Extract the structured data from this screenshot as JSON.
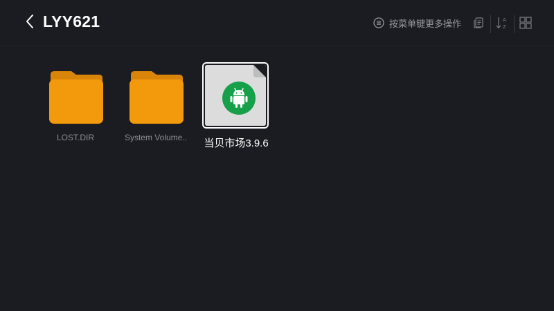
{
  "header": {
    "title": "LYY621",
    "menu_hint": "按菜单键更多操作",
    "icons": {
      "back": "chevron-left-icon",
      "menu_hint": "menu-lines-icon",
      "clipboard": "clipboard-icon",
      "sort": "sort-az-icon",
      "view": "grid-view-icon"
    }
  },
  "files": [
    {
      "name": "LOST.DIR",
      "type": "folder",
      "icon": "folder-icon"
    },
    {
      "name": "System Volume..",
      "type": "folder",
      "icon": "folder-icon"
    },
    {
      "name": "当贝市场3.9.6",
      "type": "apk",
      "icon": "android-icon",
      "selected": true
    }
  ],
  "colors": {
    "background": "#1b1c22",
    "folder": "#f39a0c",
    "folder_tab": "#d8850a",
    "apk_badge": "#17a04a",
    "selected_border": "#ffffff"
  }
}
